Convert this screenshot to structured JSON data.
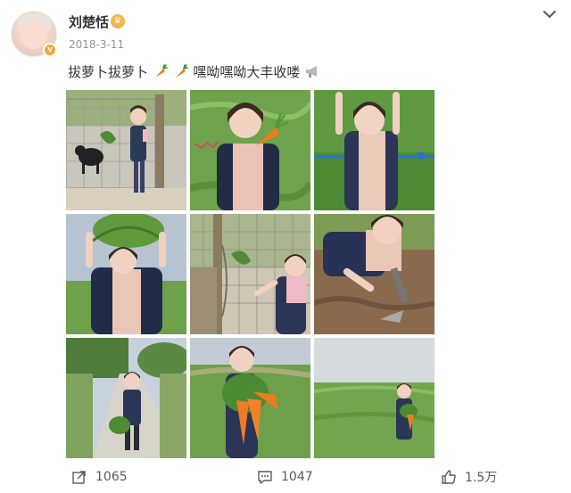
{
  "user": {
    "name": "刘楚恬",
    "date": "2018-3-11",
    "crown_icon": "crown-badge-icon",
    "verified_icon": "verified-v-icon"
  },
  "post": {
    "text_before": "拔萝卜拔萝卜",
    "emoji_1": "carrot-emoji",
    "emoji_2": "carrot-emoji",
    "text_after": "嘿呦嘿呦大丰收喽",
    "emoji_3": "megaphone-emoji"
  },
  "photos": [
    {
      "id": "photo-1",
      "scene": "girl-with-goat"
    },
    {
      "id": "photo-2",
      "scene": "girl-holding-carrot"
    },
    {
      "id": "photo-3",
      "scene": "girl-arms-raised"
    },
    {
      "id": "photo-4",
      "scene": "girl-holding-greens-overhead"
    },
    {
      "id": "photo-5",
      "scene": "girl-at-fence"
    },
    {
      "id": "photo-6",
      "scene": "girl-digging"
    },
    {
      "id": "photo-7",
      "scene": "girl-on-path"
    },
    {
      "id": "photo-8",
      "scene": "girl-with-carrot-bundle"
    },
    {
      "id": "photo-9",
      "scene": "girl-in-field"
    }
  ],
  "footer": {
    "share_count": "1065",
    "comment_count": "1047",
    "like_count": "1.5万"
  },
  "colors": {
    "accent_orange": "#f7a43b",
    "text_primary": "#333333",
    "text_secondary": "#939393"
  }
}
